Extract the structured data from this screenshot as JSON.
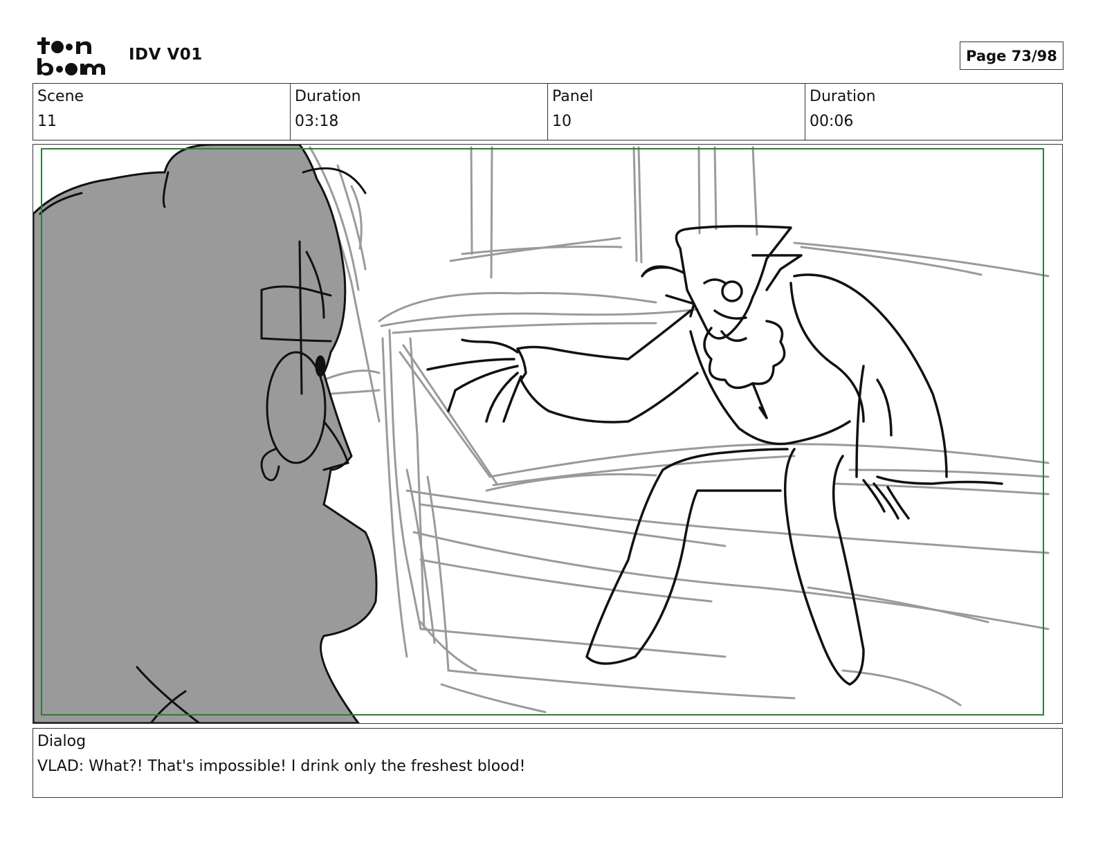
{
  "header": {
    "logo_text": "toon boom",
    "project_title": "IDV V01",
    "page_indicator": "Page 73/98"
  },
  "info": {
    "scene_label": "Scene",
    "scene_value": "11",
    "scene_duration_label": "Duration",
    "scene_duration_value": "03:18",
    "panel_label": "Panel",
    "panel_value": "10",
    "panel_duration_label": "Duration",
    "panel_duration_value": "00:06"
  },
  "dialog": {
    "label": "Dialog",
    "text": "VLAD: What?! That's impossible! I drink only the freshest blood!"
  },
  "colors": {
    "safe_frame": "#2e7d2e",
    "foreground_fill": "#9a9a9a",
    "sketch_gray": "#999999",
    "ink": "#111111"
  }
}
